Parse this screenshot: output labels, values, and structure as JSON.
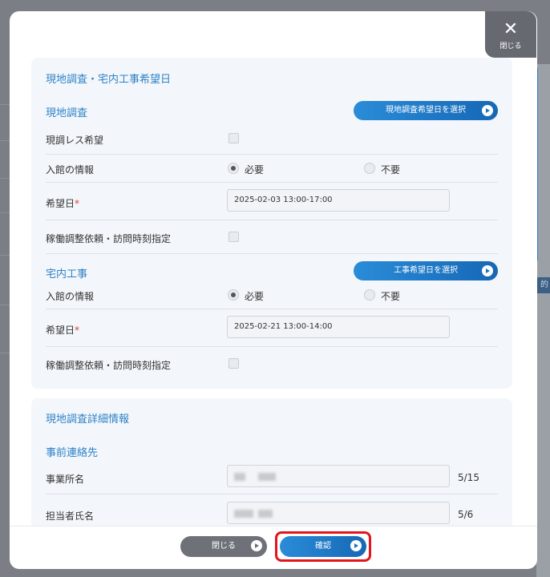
{
  "close_button": {
    "label": "閉じる"
  },
  "bg_tag": "的",
  "section1": {
    "title": "現地調査・宅内工事希望日",
    "survey": {
      "title": "現地調査",
      "select_button": "現地調査希望日を選択",
      "rows": {
        "no_survey": {
          "label": "現調レス希望"
        },
        "building_info": {
          "label": "入館の情報",
          "opt_required": "必要",
          "opt_not_required": "不要"
        },
        "desired_date": {
          "label": "希望日",
          "required_mark": "*",
          "value": "2025-02-03  13:00-17:00"
        },
        "schedule": {
          "label": "稼働調整依頼・訪問時刻指定"
        }
      }
    },
    "construction": {
      "title": "宅内工事",
      "select_button": "工事希望日を選択",
      "rows": {
        "building_info": {
          "label": "入館の情報",
          "opt_required": "必要",
          "opt_not_required": "不要"
        },
        "desired_date": {
          "label": "希望日",
          "required_mark": "*",
          "value": "2025-02-21  13:00-14:00"
        },
        "schedule": {
          "label": "稼働調整依頼・訪問時刻指定"
        }
      }
    }
  },
  "section2": {
    "title": "現地調査詳細情報",
    "contact": {
      "title": "事前連絡先",
      "office": {
        "label": "事業所名",
        "counter": "5/15"
      },
      "person": {
        "label": "担当者氏名",
        "counter": "5/6"
      }
    }
  },
  "footer": {
    "close_label": "閉じる",
    "confirm_label": "確認"
  },
  "colors": {
    "accent": "#2e83c8",
    "button": "#1d72bf",
    "highlight": "#e3141b"
  }
}
